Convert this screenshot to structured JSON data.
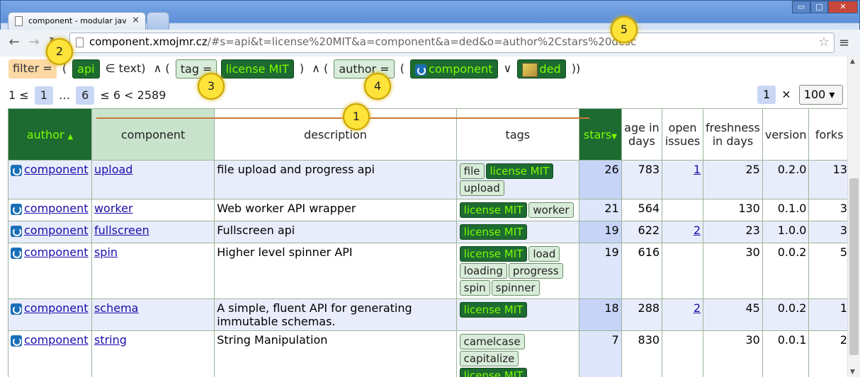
{
  "browser": {
    "tab_title": "component - modular javasc",
    "tab_close": "×",
    "url_host": "component.xmojmr.cz",
    "url_rest": "/#s=api&t=license%20MIT&a=component&a=ded&o=author%2Cstars%20desc",
    "win_min": "▭",
    "win_max": "□",
    "win_close": "✕",
    "back": "←",
    "forward": "→",
    "reload": "↻",
    "star": "☆",
    "menu": "≡"
  },
  "filter": {
    "label": "filter =",
    "open1": "(",
    "term": "api",
    "in_text": "∈ text)",
    "and1": "∧ (",
    "tag_label": "tag =",
    "tag_value": "license MIT",
    "close2": ")",
    "and2": "∧ (",
    "author_label": "author =",
    "open3": "(",
    "author1": "component",
    "or": "∨",
    "author2": "ded",
    "close3": "))"
  },
  "pager": {
    "start": "1 ≤",
    "page1": "1",
    "ellipsis": "…",
    "page6": "6",
    "end": "≤ 6 < 2589",
    "per_page_count": "1",
    "times": "×",
    "per_page": "100",
    "caret": "▾"
  },
  "columns": {
    "author": "author",
    "author_arrow": "▲",
    "component": "component",
    "description": "description",
    "tags": "tags",
    "stars": "stars",
    "stars_arrow": "▼",
    "age": "age in days",
    "issues": "open issues",
    "fresh": "freshness in days",
    "version": "version",
    "forks": "forks"
  },
  "rows": [
    {
      "author": "component",
      "component": "upload",
      "description": "file upload and progress api",
      "tags": [
        "file",
        "license MIT",
        "upload"
      ],
      "stars": "26",
      "age": "783",
      "issues": "1",
      "fresh": "25",
      "version": "0.2.0",
      "forks": "13"
    },
    {
      "author": "component",
      "component": "worker",
      "description": "Web worker API wrapper",
      "tags": [
        "license MIT",
        "worker"
      ],
      "stars": "21",
      "age": "564",
      "issues": "",
      "fresh": "130",
      "version": "0.1.0",
      "forks": "3"
    },
    {
      "author": "component",
      "component": "fullscreen",
      "description": "Fullscreen api",
      "tags": [
        "license MIT"
      ],
      "stars": "19",
      "age": "622",
      "issues": "2",
      "fresh": "23",
      "version": "1.0.0",
      "forks": "3"
    },
    {
      "author": "component",
      "component": "spin",
      "description": "Higher level spinner API",
      "tags": [
        "license MIT",
        "load",
        "loading",
        "progress",
        "spin",
        "spinner"
      ],
      "stars": "19",
      "age": "616",
      "issues": "",
      "fresh": "30",
      "version": "0.0.2",
      "forks": "5"
    },
    {
      "author": "component",
      "component": "schema",
      "description": "A simple, fluent API for generating immutable schemas.",
      "tags": [
        "license MIT"
      ],
      "stars": "18",
      "age": "288",
      "issues": "2",
      "fresh": "45",
      "version": "0.0.2",
      "forks": "1"
    },
    {
      "author": "component",
      "component": "string",
      "description": "String Manipulation",
      "tags": [
        "camelcase",
        "capitalize",
        "license MIT"
      ],
      "stars": "7",
      "age": "830",
      "issues": "",
      "fresh": "30",
      "version": "0.0.1",
      "forks": "2"
    }
  ],
  "callouts": [
    "1",
    "2",
    "3",
    "4",
    "5"
  ],
  "colors": {
    "dark_green": "#1e6b32",
    "lime": "#7cfc00",
    "light_green": "#d8ecd9",
    "blue_row": "#e9edfb",
    "callout": "#fde33a"
  }
}
